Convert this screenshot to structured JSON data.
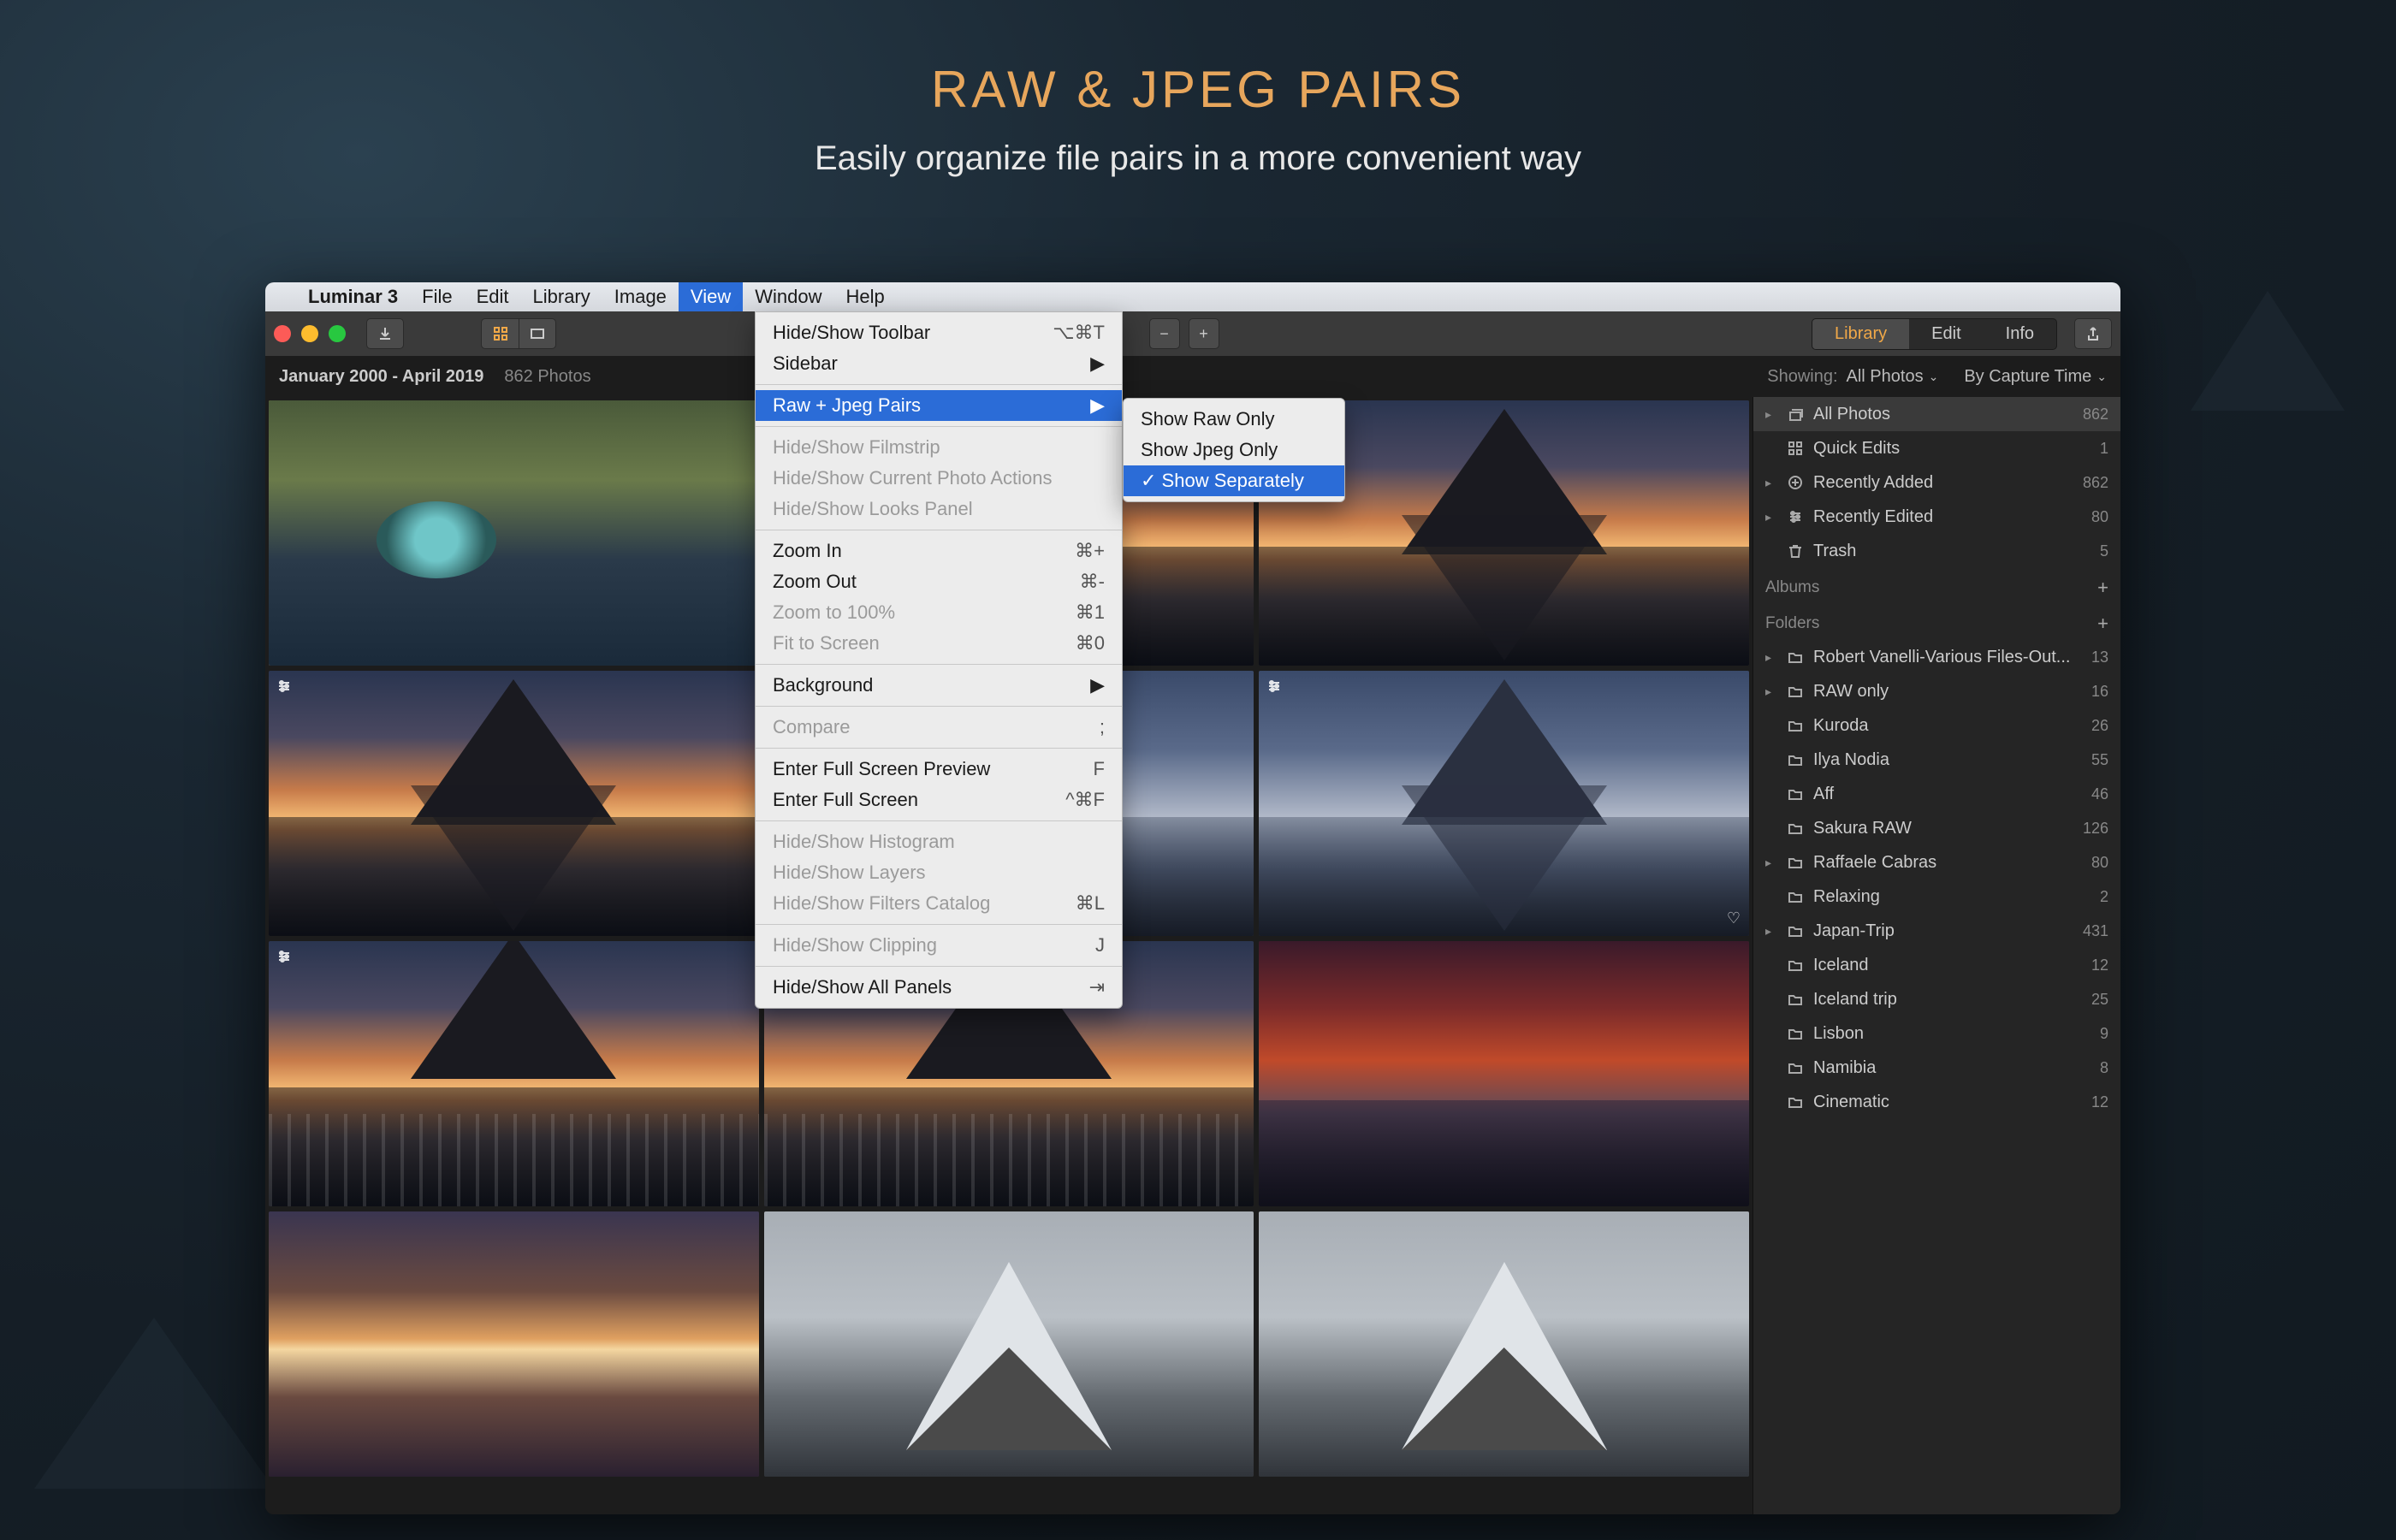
{
  "promo": {
    "title": "RAW & JPEG PAIRS",
    "subtitle": "Easily organize file pairs in a more convenient way"
  },
  "menubar": {
    "app": "Luminar 3",
    "items": [
      "File",
      "Edit",
      "Library",
      "Image",
      "View",
      "Window",
      "Help"
    ],
    "active_index": 4
  },
  "view_menu": {
    "items": [
      {
        "label": "Hide/Show Toolbar",
        "shortcut": "⌥⌘T"
      },
      {
        "label": "Sidebar",
        "submenu": true
      },
      {
        "sep": true
      },
      {
        "label": "Raw + Jpeg Pairs",
        "submenu": true,
        "highlight": true
      },
      {
        "sep": true
      },
      {
        "label": "Hide/Show Filmstrip",
        "disabled": true
      },
      {
        "label": "Hide/Show Current Photo Actions",
        "disabled": true
      },
      {
        "label": "Hide/Show Looks Panel",
        "disabled": true
      },
      {
        "sep": true
      },
      {
        "label": "Zoom In",
        "shortcut": "⌘+"
      },
      {
        "label": "Zoom Out",
        "shortcut": "⌘-"
      },
      {
        "label": "Zoom to 100%",
        "shortcut": "⌘1",
        "disabled": true
      },
      {
        "label": "Fit to Screen",
        "shortcut": "⌘0",
        "disabled": true
      },
      {
        "sep": true
      },
      {
        "label": "Background",
        "submenu": true
      },
      {
        "sep": true
      },
      {
        "label": "Compare",
        "shortcut": ";",
        "disabled": true
      },
      {
        "sep": true
      },
      {
        "label": "Enter Full Screen Preview",
        "shortcut": "F"
      },
      {
        "label": "Enter Full Screen",
        "shortcut": "^⌘F"
      },
      {
        "sep": true
      },
      {
        "label": "Hide/Show Histogram",
        "disabled": true
      },
      {
        "label": "Hide/Show Layers",
        "disabled": true
      },
      {
        "label": "Hide/Show Filters Catalog",
        "shortcut": "⌘L",
        "disabled": true
      },
      {
        "sep": true
      },
      {
        "label": "Hide/Show Clipping",
        "shortcut": "J",
        "disabled": true
      },
      {
        "sep": true
      },
      {
        "label": "Hide/Show All Panels",
        "shortcut": "⇥"
      }
    ]
  },
  "submenu": {
    "items": [
      {
        "label": "Show Raw Only"
      },
      {
        "label": "Show Jpeg Only"
      },
      {
        "label": "Show Separately",
        "checked": true,
        "highlight": true
      }
    ]
  },
  "segmented": {
    "tabs": [
      "Library",
      "Edit",
      "Info"
    ],
    "active": 0
  },
  "subheader": {
    "range": "January 2000 - April 2019",
    "count": "862 Photos",
    "showing_label": "Showing:",
    "showing_value": "All Photos",
    "sort_label": "By Capture Time"
  },
  "shortcuts": [
    {
      "name": "All Photos",
      "count": "862",
      "icon": "stack",
      "disc": true,
      "sel": true
    },
    {
      "name": "Quick Edits",
      "count": "1",
      "icon": "grid"
    },
    {
      "name": "Recently Added",
      "count": "862",
      "icon": "plus-circle",
      "disc": true
    },
    {
      "name": "Recently Edited",
      "count": "80",
      "icon": "sliders",
      "disc": true
    },
    {
      "name": "Trash",
      "count": "5",
      "icon": "trash"
    }
  ],
  "sections": {
    "albums": "Albums",
    "folders": "Folders"
  },
  "folders": [
    {
      "name": "Robert Vanelli-Various Files-Out...",
      "count": "13",
      "disc": true
    },
    {
      "name": "RAW only",
      "count": "16",
      "disc": true
    },
    {
      "name": "Kuroda",
      "count": "26"
    },
    {
      "name": "Ilya Nodia",
      "count": "55"
    },
    {
      "name": "Aff",
      "count": "46"
    },
    {
      "name": "Sakura RAW",
      "count": "126"
    },
    {
      "name": "Raffaele Cabras",
      "count": "80",
      "disc": true
    },
    {
      "name": "Relaxing",
      "count": "2"
    },
    {
      "name": "Japan-Trip",
      "count": "431",
      "disc": true
    },
    {
      "name": "Iceland",
      "count": "12"
    },
    {
      "name": "Iceland trip",
      "count": "25"
    },
    {
      "name": "Lisbon",
      "count": "9"
    },
    {
      "name": "Namibia",
      "count": "8"
    },
    {
      "name": "Cinematic",
      "count": "12"
    }
  ],
  "thumbnails": [
    {
      "style": "aerial",
      "sel": true
    },
    {
      "style": "sunset-mtn"
    },
    {
      "style": "sunset-mtn"
    },
    {
      "style": "sunset-mtn",
      "adj": true
    },
    {
      "style": "dawn",
      "adj": true
    },
    {
      "style": "dawn",
      "adj": true,
      "heart": true
    },
    {
      "style": "falls",
      "adj": true
    },
    {
      "style": "falls",
      "adj": true
    },
    {
      "style": "fiery"
    },
    {
      "style": "sunset-band"
    },
    {
      "style": "mist-peak"
    },
    {
      "style": "mist-peak"
    }
  ]
}
